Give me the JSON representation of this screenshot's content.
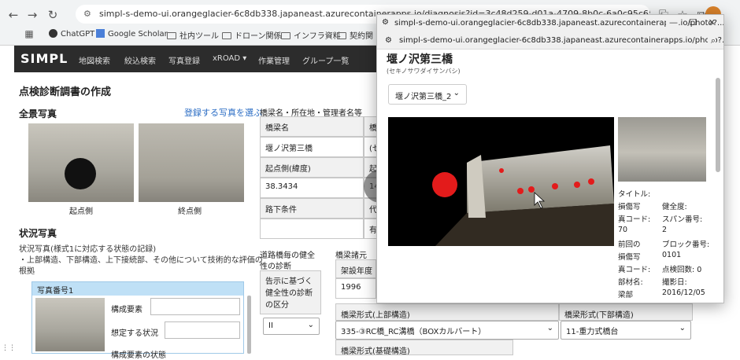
{
  "browser": {
    "url": "simpl-s-demo-ui.orangeglacier-6c8db338.japaneast.azurecontainerapps.io/diagnosis?id=3c48d259-d01a-4709-8b0c-6a0c95c652a8",
    "bookmarks": [
      "ChatGPT",
      "Google Scholar",
      "社内ツール",
      "ドローン関係",
      "インフラ資料",
      "契約関"
    ]
  },
  "navbar": {
    "logo": "SIMPL",
    "items": [
      "地図検索",
      "絞込検索",
      "写真登録",
      "xROAD",
      "作業管理",
      "グループ一覧"
    ]
  },
  "page": {
    "title": "点検診断調書の作成",
    "overview_title": "全景写真",
    "select_photo_link": "登録する写真を選ぶ",
    "captions": [
      "起点側",
      "終点側"
    ],
    "status_title": "状況写真",
    "status_desc1": "状況写真(様式1に対応する状態の記録)",
    "status_desc2": "・上部構造、下部構造、上下接続部、その他について技術的な評価の",
    "status_desc3": "根拠"
  },
  "photo_panel": {
    "header": "写真番号1",
    "fields": [
      "構成要素",
      "想定する状況",
      "構成要素の状態"
    ]
  },
  "bridge_table": {
    "title": "橋梁名・所在地・管理者名等",
    "rows": [
      "橋梁名",
      "堰ノ沢第三橋",
      "起点側(緯度)",
      "38.3434",
      "路下条件",
      ""
    ],
    "right_col": [
      "橋",
      "(セ",
      "起",
      "14",
      "代",
      "有"
    ]
  },
  "health": {
    "title_line1": "道路橋毎の健全",
    "title_line2": "性の診断",
    "box_line1": "告示に基づく",
    "box_line2": "健全性の診断",
    "box_line3": "の区分",
    "value": "II"
  },
  "specs": {
    "title": "橋梁諸元",
    "year_label": "架設年度",
    "year_value": "1996",
    "upper_label": "橋梁形式(上部構造)",
    "upper_value": "335-③RC橋_RC溝橋（BOXカルバート）",
    "lower_label": "橋梁形式(下部構造)",
    "lower_value": "11-重力式橋台",
    "foundation_label": "橋梁形式(基礎構造)"
  },
  "popup": {
    "window_url": "simpl-s-demo-ui.orangeglacier-6c8db338.japaneast.azurecontainerapps.io/photo?...",
    "address_url": "simpl-s-demo-ui.orangeglacier-6c8db338.japaneast.azurecontainerapps.io/photo?...",
    "bridge_name": "堰ノ沢第三橋",
    "bridge_kana": "(セキノサワダイサンバシ)",
    "dropdown_value": "堰ノ沢第三橋_2",
    "meta_left": [
      "タイトル:",
      "損傷写",
      "真コード:",
      "70",
      "前回の",
      "損傷写",
      "真コード:",
      "部材名:",
      "梁部"
    ],
    "meta_right": [
      "健全度:",
      "スパン番号:",
      "2",
      "ブロック番号:",
      "0101",
      "点検回数: 0",
      "撮影日:",
      "2016/12/05"
    ]
  },
  "colors": {
    "navbar": "#2c2c2c",
    "link": "#2a6cc4",
    "photo_header": "#bfe0f6",
    "damage_marker": "#e31b1b"
  }
}
